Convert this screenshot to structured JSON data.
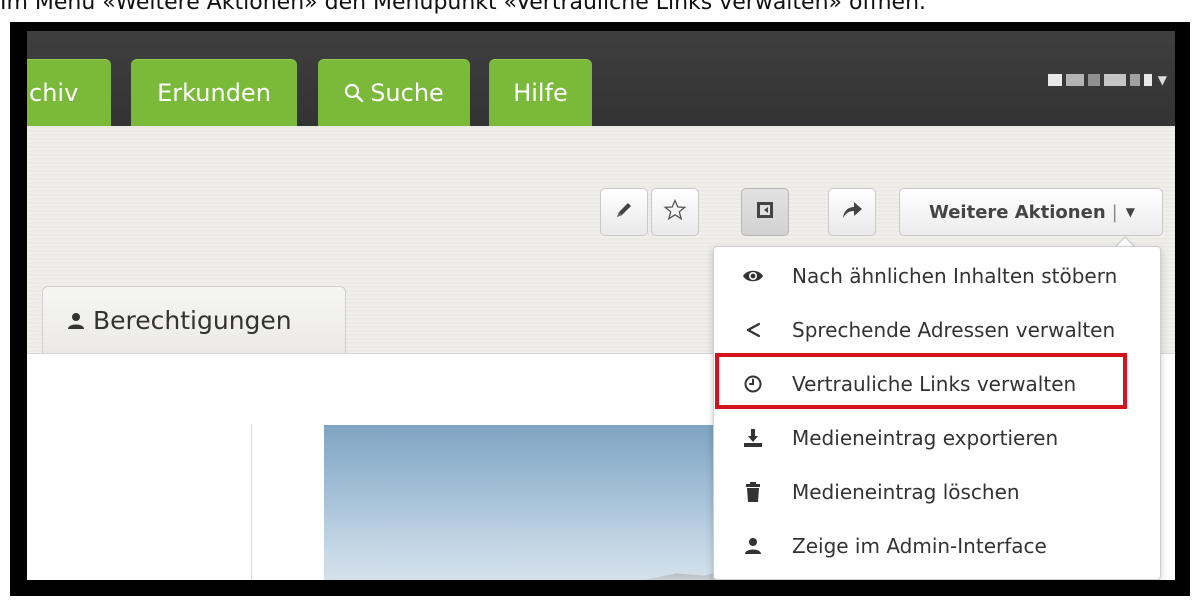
{
  "caption": "Im Menü «Weitere Aktionen» den Menüpunkt «Vertrauliche Links verwalten» öffnen.",
  "nav": {
    "tabs": [
      {
        "label": "chiv"
      },
      {
        "label": "Erkunden"
      },
      {
        "label": "Suche",
        "icon": "search-icon"
      },
      {
        "label": "Hilfe"
      }
    ]
  },
  "toolbar": {
    "edit_icon": "pencil-icon",
    "favorite_icon": "star-icon",
    "embed_icon": "embed-icon",
    "share_icon": "share-icon",
    "more_actions_label": "Weitere Aktionen",
    "more_actions_sep": "|",
    "more_actions_arrow": "▼"
  },
  "tabs": {
    "permissions_label": "Berechtigungen",
    "permissions_icon": "user-icon"
  },
  "menu": {
    "items": [
      {
        "label": "Nach ähnlichen Inhalten stöbern",
        "icon": "eye-icon"
      },
      {
        "label": "Sprechende Adressen verwalten",
        "icon": "share-nodes-icon"
      },
      {
        "label": "Vertrauliche Links verwalten",
        "icon": "clock-icon"
      },
      {
        "label": "Medieneintrag exportieren",
        "icon": "download-icon"
      },
      {
        "label": "Medieneintrag löschen",
        "icon": "trash-icon"
      },
      {
        "label": "Zeige im Admin-Interface",
        "icon": "user-icon"
      }
    ]
  },
  "colors": {
    "nav_tab": "#7ab93a",
    "highlight": "#d4141c",
    "navbar": "#3a3a3a"
  }
}
